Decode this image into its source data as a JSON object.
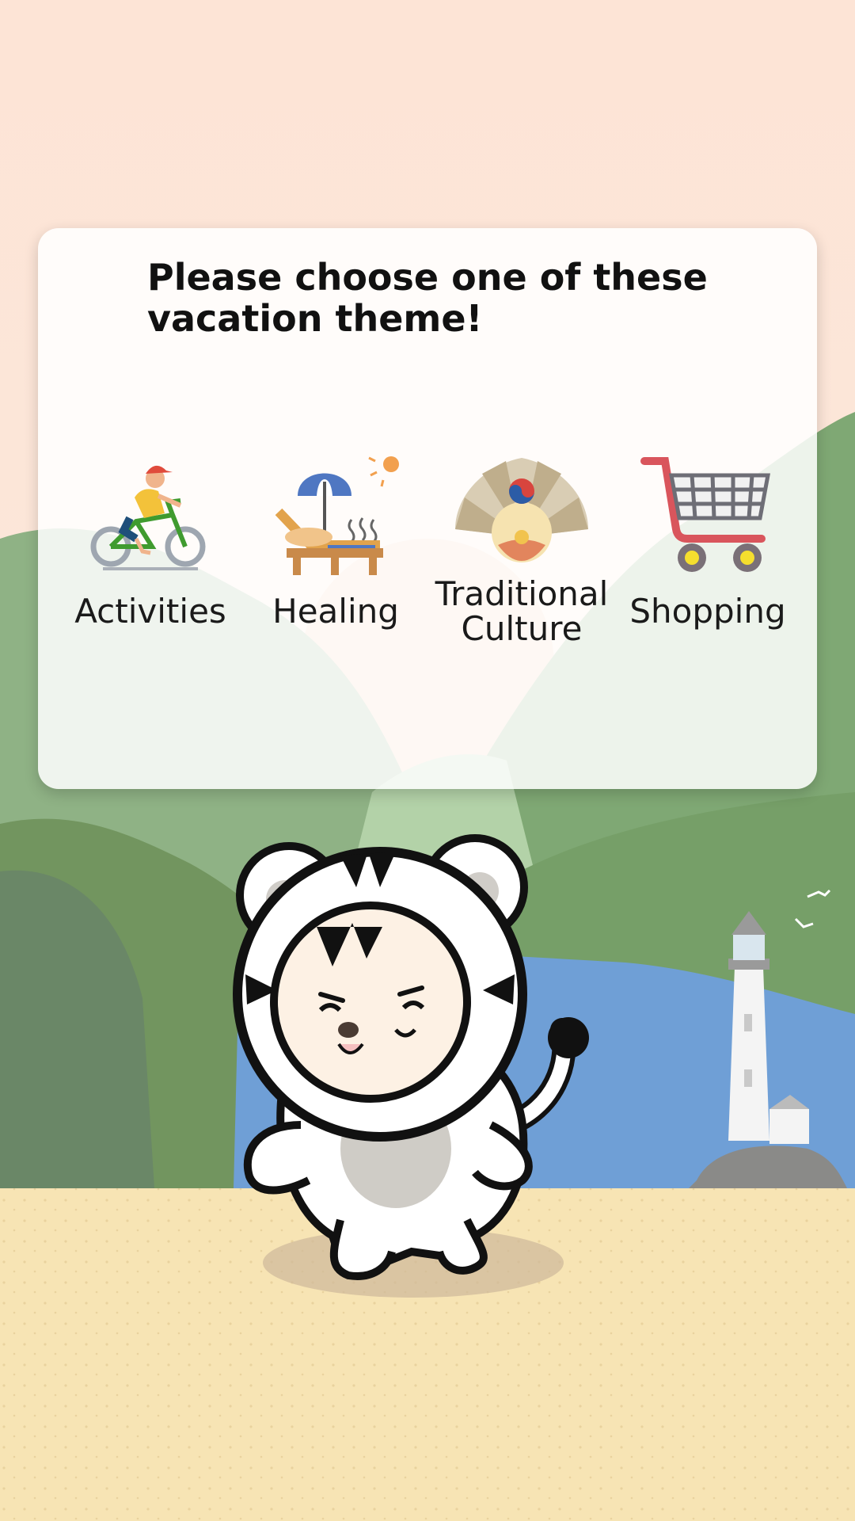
{
  "dialog": {
    "title": "Please choose one of these vacation theme!"
  },
  "themes": [
    {
      "label": "Activities",
      "icon": "cyclist-icon"
    },
    {
      "label": "Healing",
      "icon": "beach-lounger-icon"
    },
    {
      "label": "Traditional Culture",
      "icon": "folding-fan-icon"
    },
    {
      "label": "Shopping",
      "icon": "shopping-cart-icon"
    }
  ],
  "background": {
    "sky": "#fbe6d6",
    "hills": "#7f9f73",
    "sea": "#6f9fd6",
    "sand": "#f7e4b4"
  }
}
